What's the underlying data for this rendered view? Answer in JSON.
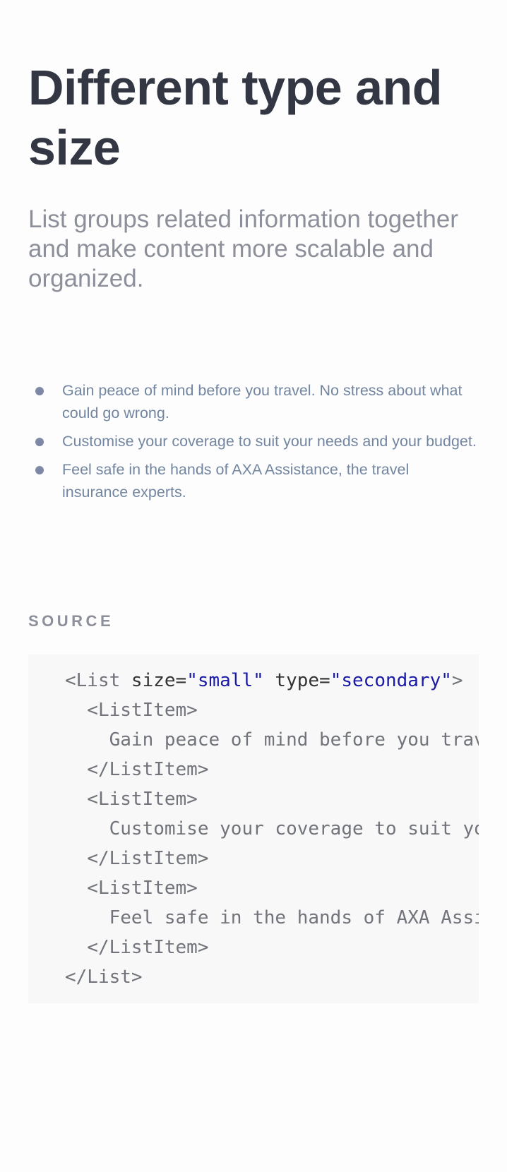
{
  "heading": {
    "title": "Different type and size",
    "subtitle": "List groups related information together and make content more scalable and organized."
  },
  "list": {
    "items": [
      "Gain peace of mind before you travel. No stress about what could go wrong.",
      "Customise your coverage to suit your needs and your budget.",
      "Feel safe in the hands of AXA Assistance, the travel insurance experts."
    ]
  },
  "source": {
    "label": "SOURCE",
    "code": {
      "line1": {
        "open": "<List",
        "attr1": " size=",
        "val1": "\"small\"",
        "attr2": " type=",
        "val2": "\"secondary\"",
        "close": ">"
      },
      "line2": "  <ListItem>",
      "line3": "    Gain peace of mind before you travel. No stress about what could go wrong.",
      "line4": "  </ListItem>",
      "line5": "  <ListItem>",
      "line6": "    Customise your coverage to suit your needs and your budget.",
      "line7": "  </ListItem>",
      "line8": "  <ListItem>",
      "line9": "    Feel safe in the hands of AXA Assistance, the travel insurance experts.",
      "line10": "  </ListItem>",
      "line11": "</List>"
    }
  },
  "colors": {
    "title": "#323743",
    "subtitle": "#8d909a",
    "list_text": "#7386a1",
    "bullet": "#7c88a5",
    "code_bg": "#f8f8f8",
    "code_text": "#72747b",
    "code_string": "#1a1aa6"
  }
}
